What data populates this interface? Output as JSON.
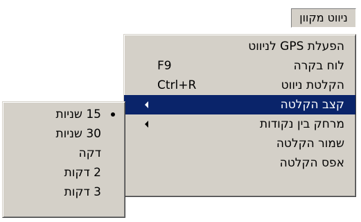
{
  "menubar": {
    "title": "ניווט מקוון"
  },
  "main_menu": {
    "items": [
      {
        "label": "הפעלת GPS לניווט",
        "shortcut": ""
      },
      {
        "label": "לוח בקרה",
        "shortcut": "F9"
      },
      {
        "label": "הקלטת ניווט",
        "shortcut": "Ctrl+R"
      },
      {
        "label": "קצב הקלטה",
        "shortcut": "",
        "submenu": true,
        "highlighted": true
      },
      {
        "label": "מרחק בין נקודות",
        "shortcut": "",
        "submenu": true
      },
      {
        "label": "שמור הקלטה",
        "shortcut": ""
      },
      {
        "label": "אפס הקלטה",
        "shortcut": ""
      }
    ]
  },
  "sub_menu": {
    "items": [
      {
        "label": "15 שניות",
        "checked": true
      },
      {
        "label": "30 שניות",
        "checked": false
      },
      {
        "label": "דקה",
        "checked": false
      },
      {
        "label": "2 דקות",
        "checked": false
      },
      {
        "label": "3 דקות",
        "checked": false
      }
    ]
  },
  "colors": {
    "menu_face": "#d4d0c8",
    "highlight": "#0a246a",
    "highlight_text": "#ffffff"
  }
}
